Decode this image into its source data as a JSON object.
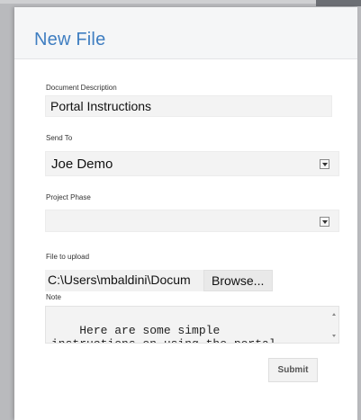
{
  "dialog": {
    "title": "New File",
    "submit_label": "Submit"
  },
  "form": {
    "description_label": "Document Description",
    "description_value": "Portal Instructions",
    "send_to_label": "Send To",
    "send_to_value": "Joe Demo",
    "project_phase_label": "Project Phase",
    "project_phase_value": "",
    "file_label": "File to upload",
    "file_path": "C:\\Users\\mbaldini\\Docum",
    "browse_label": "Browse...",
    "note_label": "Note",
    "note_value": "Here are some simple\ninstructions on using the portal."
  },
  "colors": {
    "title": "#3f7ec1",
    "backdrop": "#b9babd"
  },
  "icons": {
    "dropdown": "chevron-down-icon",
    "scroll_up": "scroll-up-arrow-icon",
    "scroll_down": "scroll-down-arrow-icon"
  }
}
